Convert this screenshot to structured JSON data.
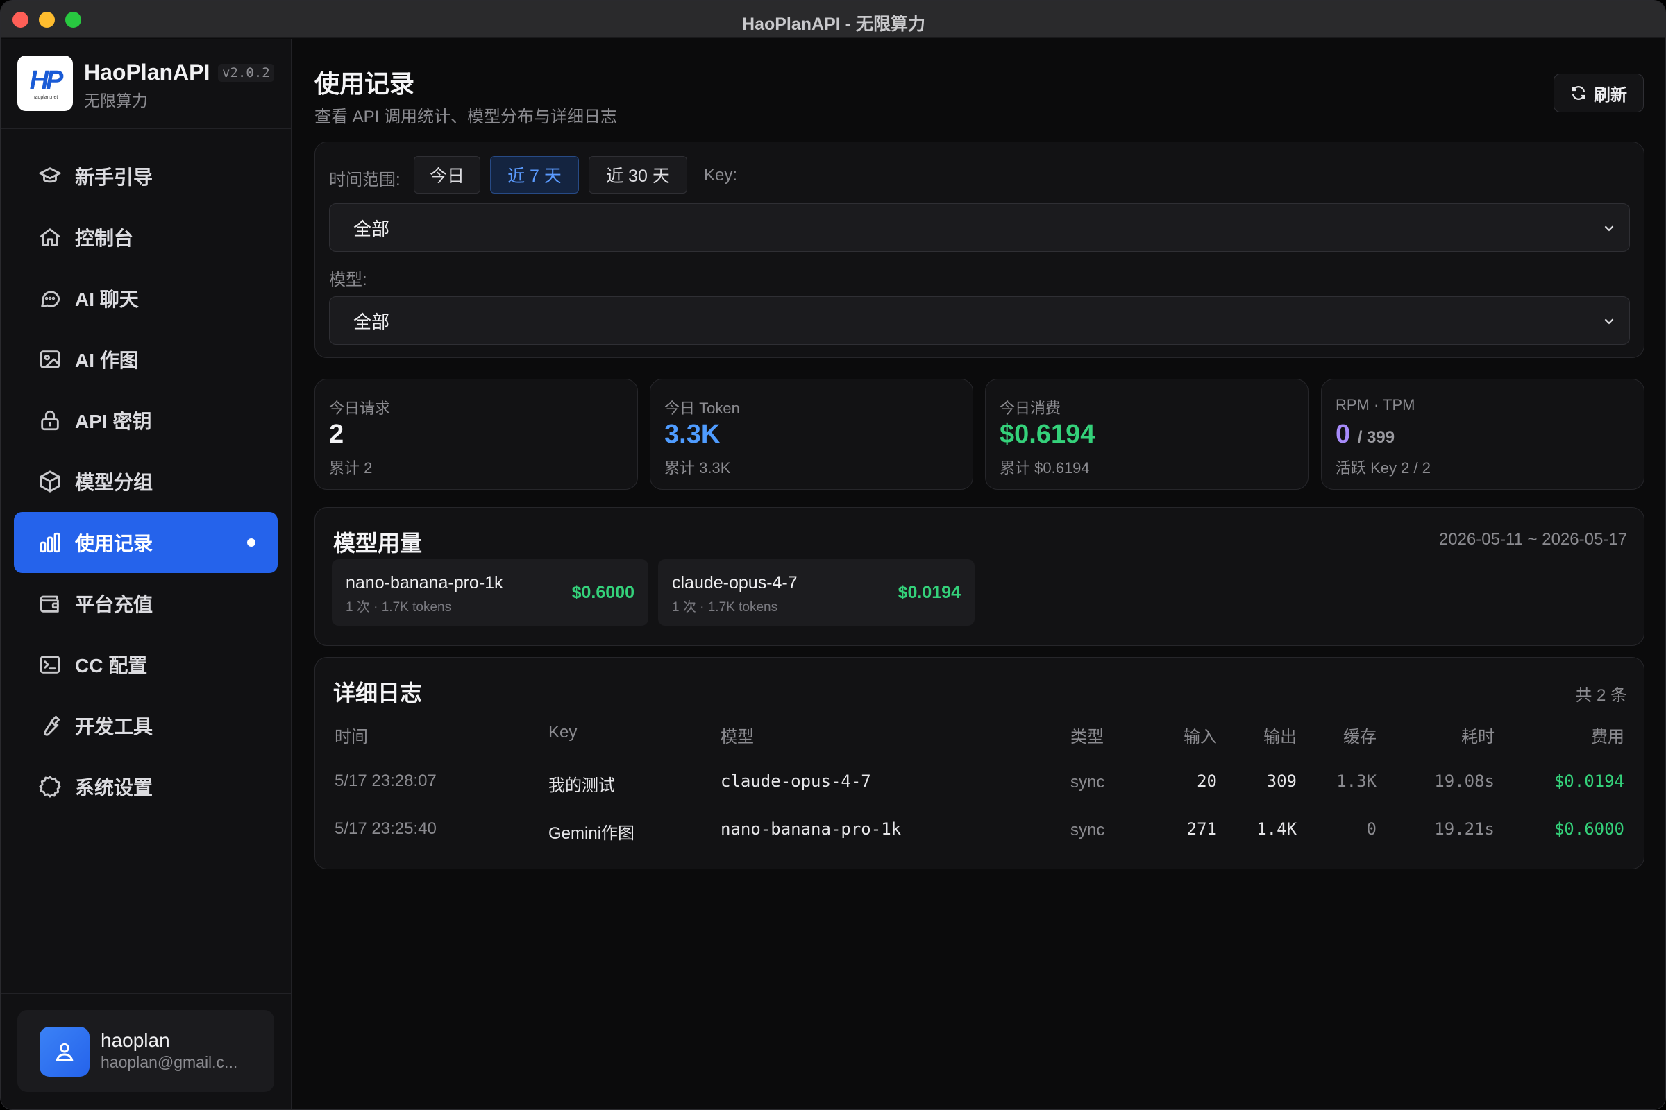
{
  "window": {
    "title": "HaoPlanAPI - 无限算力"
  },
  "brand": {
    "name": "HaoPlanAPI",
    "version": "v2.0.2",
    "subtitle": "无限算力",
    "logo_text": "HP",
    "logo_domain": "haoplan.net"
  },
  "nav": [
    {
      "label": "新手引导",
      "icon": "graduation-cap-icon"
    },
    {
      "label": "控制台",
      "icon": "home-icon"
    },
    {
      "label": "AI 聊天",
      "icon": "chat-bubble-icon"
    },
    {
      "label": "AI 作图",
      "icon": "image-icon"
    },
    {
      "label": "API 密钥",
      "icon": "lock-icon"
    },
    {
      "label": "模型分组",
      "icon": "cube-icon"
    },
    {
      "label": "使用记录",
      "icon": "bar-chart-icon",
      "active": true
    },
    {
      "label": "平台充值",
      "icon": "wallet-icon"
    },
    {
      "label": "CC 配置",
      "icon": "terminal-icon"
    },
    {
      "label": "开发工具",
      "icon": "wrench-icon"
    },
    {
      "label": "系统设置",
      "icon": "gear-icon"
    }
  ],
  "user": {
    "name": "haoplan",
    "email": "haoplan@gmail.c..."
  },
  "page": {
    "title": "使用记录",
    "subtitle": "查看 API 调用统计、模型分布与详细日志",
    "refresh_label": "刷新"
  },
  "filters": {
    "time_label": "时间范围:",
    "ranges": [
      "今日",
      "近 7 天",
      "近 30 天"
    ],
    "active_range": "近 7 天",
    "key_label": "Key:",
    "key_value": "全部",
    "model_label": "模型:",
    "model_value": "全部"
  },
  "stats": [
    {
      "label": "今日请求",
      "value": "2",
      "sub": "累计 2",
      "color": "#f4f4f6"
    },
    {
      "label": "今日 Token",
      "value": "3.3K",
      "sub": "累计 3.3K",
      "color": "#4f9cff"
    },
    {
      "label": "今日消费",
      "value": "$0.6194",
      "sub": "累计 $0.6194",
      "color": "#34d17a"
    },
    {
      "label": "RPM · TPM",
      "value": "0",
      "value_suffix": "/ 399",
      "sub": "活跃 Key 2 / 2",
      "color": "#a78bfa"
    }
  ],
  "usage": {
    "title": "模型用量",
    "range": "2026-05-11 ~ 2026-05-17",
    "models": [
      {
        "name": "nano-banana-pro-1k",
        "meta": "1 次 · 1.7K tokens",
        "cost": "$0.6000"
      },
      {
        "name": "claude-opus-4-7",
        "meta": "1 次 · 1.7K tokens",
        "cost": "$0.0194"
      }
    ]
  },
  "logs": {
    "title": "详细日志",
    "count": "共 2 条",
    "columns": [
      "时间",
      "Key",
      "模型",
      "类型",
      "输入",
      "输出",
      "缓存",
      "耗时",
      "费用"
    ],
    "rows": [
      [
        "5/17 23:28:07",
        "我的测试",
        "claude-opus-4-7",
        "sync",
        "20",
        "309",
        "1.3K",
        "19.08s",
        "$0.0194"
      ],
      [
        "5/17 23:25:40",
        "Gemini作图",
        "nano-banana-pro-1k",
        "sync",
        "271",
        "1.4K",
        "0",
        "19.21s",
        "$0.6000"
      ]
    ]
  },
  "colors": {
    "accent": "#2563eb",
    "green": "#34d17a",
    "blue": "#4f9cff",
    "purple": "#a78bfa"
  }
}
